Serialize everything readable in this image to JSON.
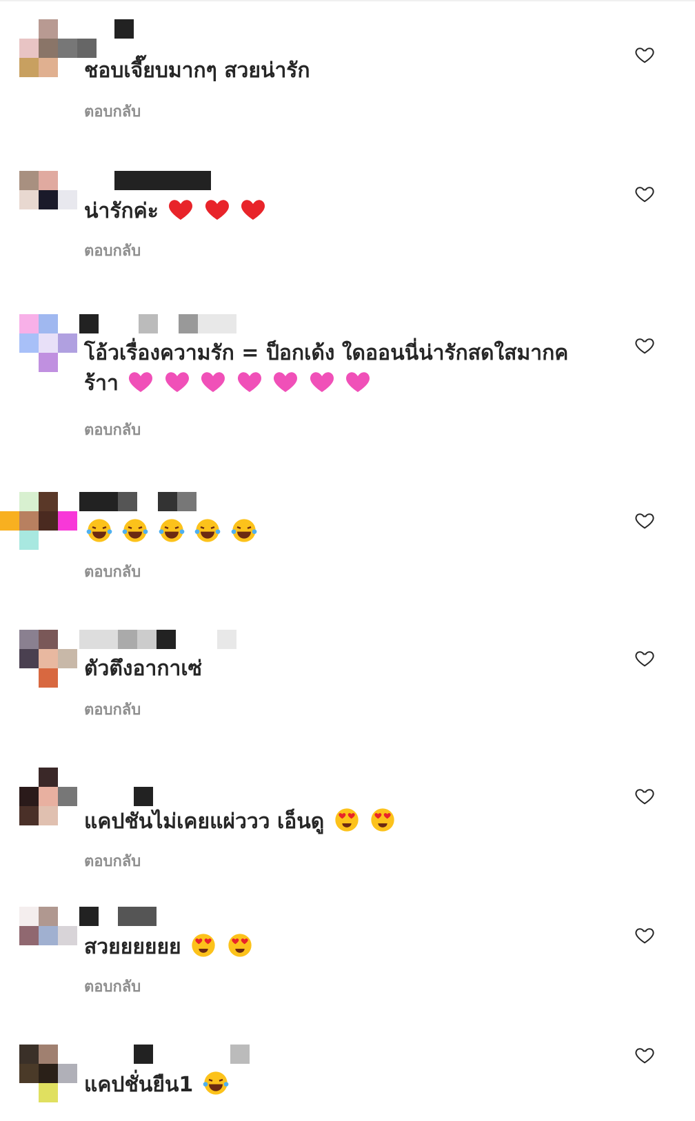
{
  "reply_label": "ตอบกลับ",
  "colors": {
    "text": "#262626",
    "secondary": "#8e8e8e",
    "heart_outline": "#262626"
  },
  "icons": {
    "like": "heart-outline-icon"
  },
  "comments": [
    {
      "text": "ชอบเจี๊ยบมากๆ สวยน่ารัก",
      "emojis": []
    },
    {
      "text": "น่ารักค่ะ",
      "emojis": [
        "red-heart",
        "red-heart",
        "red-heart"
      ]
    },
    {
      "text": "โอ้วเรื่องความรัก = ป็อกเด้ง ใดออนนี่น่ารักสดใสมากค ร้าา",
      "emojis": [
        "pink-heart",
        "pink-heart",
        "pink-heart",
        "pink-heart",
        "pink-heart",
        "pink-heart",
        "pink-heart"
      ]
    },
    {
      "text": "",
      "emojis": [
        "laugh-tears",
        "laugh-tears",
        "laugh-tears",
        "laugh-tears",
        "laugh-tears"
      ]
    },
    {
      "text": "ตัวตึงอากาเซ่",
      "emojis": []
    },
    {
      "text": "แคปชันไม่เคยแผ่ววว เอ็นดู",
      "emojis": [
        "heart-eyes",
        "heart-eyes"
      ]
    },
    {
      "text": "สวยยยยยย",
      "emojis": [
        "heart-eyes",
        "heart-eyes"
      ]
    },
    {
      "text": "แคปชั่นยืน1",
      "emojis": [
        "laugh-tears"
      ]
    }
  ]
}
